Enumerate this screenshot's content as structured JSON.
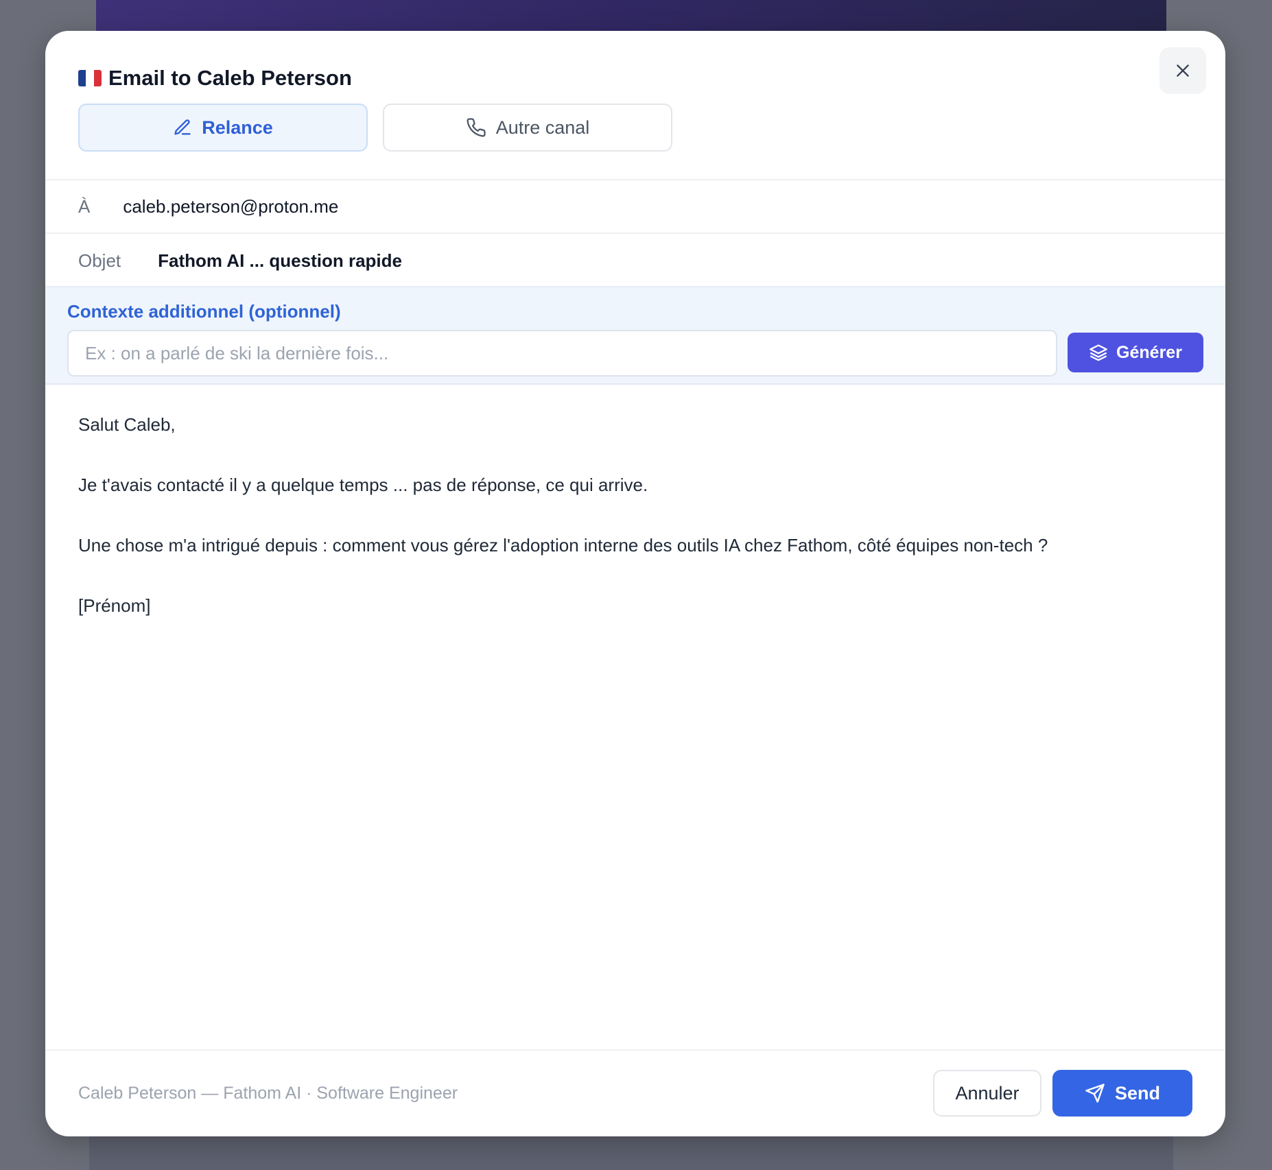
{
  "modal": {
    "title": "Email to Caleb Peterson",
    "flag": [
      "#1f3f8f",
      "#ffffff",
      "#d9303a"
    ]
  },
  "tabs": [
    {
      "label": "Relance",
      "icon": "pencil-icon",
      "active": true
    },
    {
      "label": "Autre canal",
      "icon": "phone-icon",
      "active": false
    }
  ],
  "recipient": {
    "label": "À",
    "value": "caleb.peterson@proton.me"
  },
  "subject": {
    "label": "Objet",
    "value": "Fathom AI ... question rapide"
  },
  "context": {
    "label": "Contexte additionnel (optionnel)",
    "placeholder": "Ex : on a parlé de ski la dernière fois...",
    "value": "",
    "generate_label": "Générer"
  },
  "message": {
    "paragraphs": [
      "Salut Caleb,",
      "Je t'avais contacté il y a quelque temps ... pas de réponse, ce qui arrive.",
      "Une chose m'a intrigué depuis : comment vous gérez l'adoption interne des outils IA chez Fathom, côté équipes non-tech ?",
      "[Prénom]"
    ]
  },
  "footer": {
    "info": "Caleb Peterson — Fathom AI · Software Engineer",
    "cancel_label": "Annuler",
    "send_label": "Send"
  },
  "colors": {
    "primary": "#3465e4",
    "generate": "#4f52e0",
    "accent_text": "#2f63d6"
  }
}
